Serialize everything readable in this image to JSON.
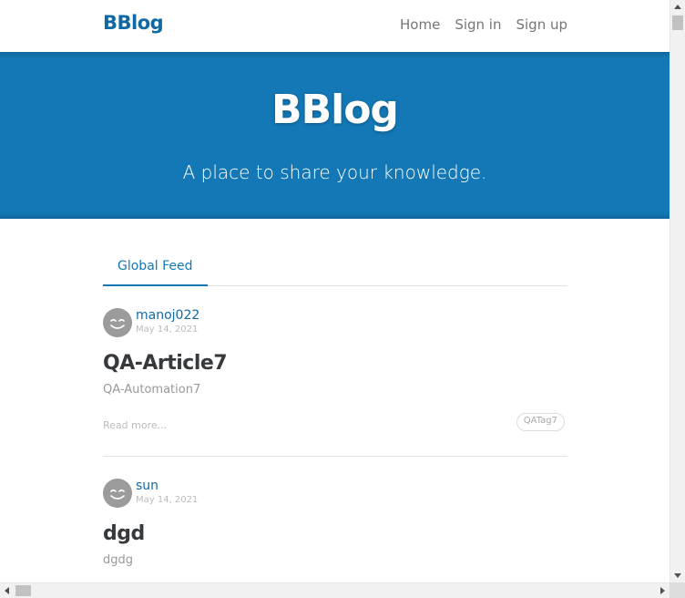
{
  "navbar": {
    "brand": "BBlog",
    "links": {
      "home": "Home",
      "sign_in": "Sign in",
      "sign_up": "Sign up"
    }
  },
  "banner": {
    "title": "BBlog",
    "subtitle": "A place to share your knowledge."
  },
  "feed": {
    "active_tab": "Global Feed",
    "articles": [
      {
        "author": "manoj022",
        "date": "May 14, 2021",
        "title": "QA-Article7",
        "description": "QA-Automation7",
        "read_more": "Read more...",
        "tags": [
          "QATag7"
        ],
        "avatar_icon": "smiley-icon"
      },
      {
        "author": "sun",
        "date": "May 14, 2021",
        "title": "dgd",
        "description": "dgdg",
        "avatar_icon": "smiley-icon"
      }
    ]
  },
  "colors": {
    "brand": "#1169a3",
    "banner_bg": "#1378b5",
    "muted": "#bbbbbb"
  }
}
